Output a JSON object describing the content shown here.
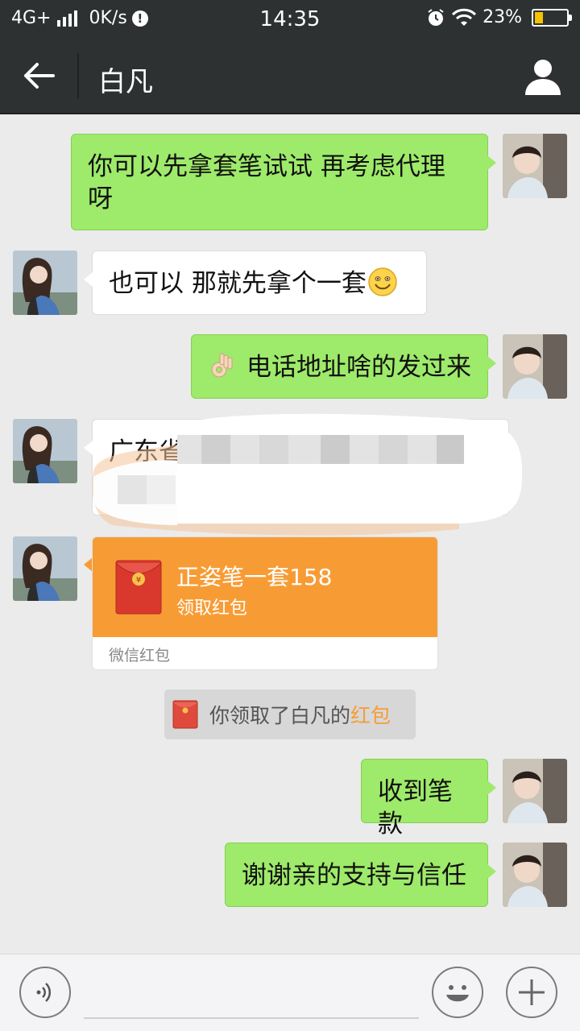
{
  "status_bar": {
    "network": "4G+",
    "speed": "0K/s",
    "time": "14:35",
    "battery": "23%",
    "battery_level": 0.23
  },
  "header": {
    "title": "白凡"
  },
  "messages": [
    {
      "side": "right",
      "text_line1": "你可以先拿套笔试试  再考虑代理",
      "text_line2": "呀"
    },
    {
      "side": "left",
      "text": "也可以  那就先拿个一套"
    },
    {
      "side": "right",
      "text": "电话地址啥的发过来"
    },
    {
      "side": "left",
      "text": "广东省"
    },
    {
      "side": "left",
      "type": "red_packet",
      "title": "正姿笔一套158",
      "action": "领取红包",
      "footer": "微信红包",
      "icon_symbol": "¥"
    },
    {
      "side": "right",
      "text": "收到笔款"
    },
    {
      "side": "right",
      "text": "谢谢亲的支持与信任"
    }
  ],
  "system_notice": {
    "prefix": "你领取了白凡的",
    "highlight": "红包"
  },
  "input_bar": {
    "placeholder": ""
  },
  "colors": {
    "bar_dark": "#2e3132",
    "bubble_green": "#9eea6a",
    "packet_orange": "#f79c35",
    "chat_bg": "#ebebeb"
  }
}
